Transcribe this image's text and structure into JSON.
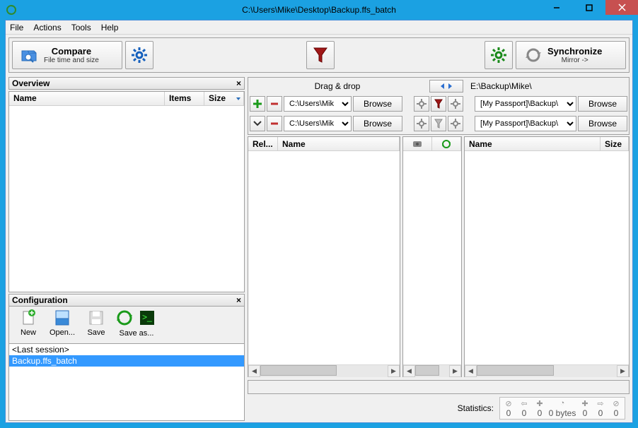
{
  "window": {
    "title": "C:\\Users\\Mike\\Desktop\\Backup.ffs_batch"
  },
  "menu": {
    "file": "File",
    "actions": "Actions",
    "tools": "Tools",
    "help": "Help"
  },
  "toolbar": {
    "compare": {
      "title": "Compare",
      "subtitle": "File time and size"
    },
    "sync": {
      "title": "Synchronize",
      "subtitle": "Mirror ->"
    }
  },
  "overview": {
    "title": "Overview",
    "cols": {
      "name": "Name",
      "items": "Items",
      "size": "Size"
    }
  },
  "config": {
    "title": "Configuration",
    "buttons": {
      "new": "New",
      "open": "Open...",
      "save": "Save",
      "saveas": "Save as..."
    },
    "list": {
      "last": "<Last session>",
      "item": "Backup.ffs_batch"
    }
  },
  "paths": {
    "dragdrop": "Drag & drop",
    "destlabel": "E:\\Backup\\Mike\\",
    "left1": "C:\\Users\\Mik",
    "left2": "C:\\Users\\Mik",
    "right1": "[My Passport]\\Backup\\",
    "right2": "[My Passport]\\Backup\\",
    "browse": "Browse"
  },
  "grid": {
    "rel": "Rel...",
    "name": "Name",
    "size": "Size"
  },
  "stats": {
    "label": "Statistics:",
    "v1": "0",
    "v2": "0",
    "v3": "0",
    "v4": "0 bytes",
    "v5": "0",
    "v6": "0",
    "v7": "0"
  }
}
